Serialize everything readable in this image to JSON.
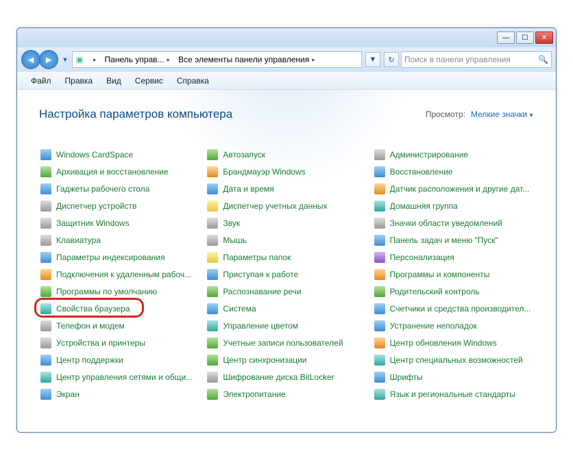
{
  "titlebar": {
    "min": "—",
    "max": "☐",
    "close": "✕"
  },
  "nav": {
    "back": "◄",
    "forward": "►",
    "history_drop": "▼",
    "refresh": "↻",
    "dropdown": "▼"
  },
  "breadcrumb": {
    "icon_glyph": "▣",
    "seg1": "Панель управ...",
    "seg2": "Все элементы панели управления",
    "arrow": "▸"
  },
  "search": {
    "placeholder": "Поиск в панели управления",
    "icon": "🔍"
  },
  "menu": {
    "file": "Файл",
    "edit": "Правка",
    "view": "Вид",
    "tools": "Сервис",
    "help": "Справка"
  },
  "header": {
    "title": "Настройка параметров компьютера",
    "view_label": "Просмотр:",
    "view_value": "Мелкие значки",
    "dd": "▼"
  },
  "columns": [
    [
      {
        "label": "Windows CardSpace",
        "ic": "ic-blue"
      },
      {
        "label": "Архивация и восстановление",
        "ic": "ic-green"
      },
      {
        "label": "Гаджеты рабочего стола",
        "ic": "ic-blue"
      },
      {
        "label": "Диспетчер устройств",
        "ic": "ic-grey"
      },
      {
        "label": "Защитник Windows",
        "ic": "ic-grey"
      },
      {
        "label": "Клавиатура",
        "ic": "ic-grey"
      },
      {
        "label": "Параметры индексирования",
        "ic": "ic-blue"
      },
      {
        "label": "Подключения к удаленным рабоч...",
        "ic": "ic-orange"
      },
      {
        "label": "Программы по умолчанию",
        "ic": "ic-green"
      },
      {
        "label": "Свойства браузера",
        "ic": "ic-teal"
      },
      {
        "label": "Телефон и модем",
        "ic": "ic-grey"
      },
      {
        "label": "Устройства и принтеры",
        "ic": "ic-grey"
      },
      {
        "label": "Центр поддержки",
        "ic": "ic-blue"
      },
      {
        "label": "Центр управления сетями и общи...",
        "ic": "ic-teal"
      },
      {
        "label": "Экран",
        "ic": "ic-blue"
      }
    ],
    [
      {
        "label": "Автозапуск",
        "ic": "ic-green"
      },
      {
        "label": "Брандмауэр Windows",
        "ic": "ic-orange"
      },
      {
        "label": "Дата и время",
        "ic": "ic-blue"
      },
      {
        "label": "Диспетчер учетных данных",
        "ic": "ic-yellow"
      },
      {
        "label": "Звук",
        "ic": "ic-grey"
      },
      {
        "label": "Мышь",
        "ic": "ic-grey"
      },
      {
        "label": "Параметры папок",
        "ic": "ic-yellow"
      },
      {
        "label": "Приступая к работе",
        "ic": "ic-blue"
      },
      {
        "label": "Распознавание речи",
        "ic": "ic-green"
      },
      {
        "label": "Система",
        "ic": "ic-blue"
      },
      {
        "label": "Управление цветом",
        "ic": "ic-teal"
      },
      {
        "label": "Учетные записи пользователей",
        "ic": "ic-green"
      },
      {
        "label": "Центр синхронизации",
        "ic": "ic-green"
      },
      {
        "label": "Шифрование диска BitLocker",
        "ic": "ic-grey"
      },
      {
        "label": "Электропитание",
        "ic": "ic-green"
      }
    ],
    [
      {
        "label": "Администрирование",
        "ic": "ic-grey"
      },
      {
        "label": "Восстановление",
        "ic": "ic-blue"
      },
      {
        "label": "Датчик расположения и другие дат...",
        "ic": "ic-orange"
      },
      {
        "label": "Домашняя группа",
        "ic": "ic-teal"
      },
      {
        "label": "Значки области уведомлений",
        "ic": "ic-grey"
      },
      {
        "label": "Панель задач и меню \"Пуск\"",
        "ic": "ic-blue"
      },
      {
        "label": "Персонализация",
        "ic": "ic-purple"
      },
      {
        "label": "Программы и компоненты",
        "ic": "ic-orange"
      },
      {
        "label": "Родительский контроль",
        "ic": "ic-green"
      },
      {
        "label": "Счетчики и средства производител...",
        "ic": "ic-blue"
      },
      {
        "label": "Устранение неполадок",
        "ic": "ic-blue"
      },
      {
        "label": "Центр обновления Windows",
        "ic": "ic-orange"
      },
      {
        "label": "Центр специальных возможностей",
        "ic": "ic-teal"
      },
      {
        "label": "Шрифты",
        "ic": "ic-blue"
      },
      {
        "label": "Язык и региональные стандарты",
        "ic": "ic-teal"
      }
    ]
  ],
  "highlight": {
    "col": 0,
    "row": 9
  }
}
